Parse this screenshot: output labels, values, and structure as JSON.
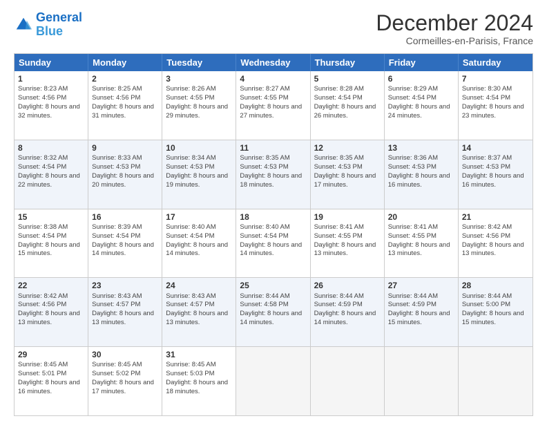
{
  "header": {
    "logo_line1": "General",
    "logo_line2": "Blue",
    "month": "December 2024",
    "location": "Cormeilles-en-Parisis, France"
  },
  "weekdays": [
    "Sunday",
    "Monday",
    "Tuesday",
    "Wednesday",
    "Thursday",
    "Friday",
    "Saturday"
  ],
  "rows": [
    [
      {
        "day": "1",
        "rise": "8:23 AM",
        "set": "4:56 PM",
        "daylight": "8 hours and 32 minutes"
      },
      {
        "day": "2",
        "rise": "8:25 AM",
        "set": "4:56 PM",
        "daylight": "8 hours and 31 minutes"
      },
      {
        "day": "3",
        "rise": "8:26 AM",
        "set": "4:55 PM",
        "daylight": "8 hours and 29 minutes"
      },
      {
        "day": "4",
        "rise": "8:27 AM",
        "set": "4:55 PM",
        "daylight": "8 hours and 27 minutes"
      },
      {
        "day": "5",
        "rise": "8:28 AM",
        "set": "4:54 PM",
        "daylight": "8 hours and 26 minutes"
      },
      {
        "day": "6",
        "rise": "8:29 AM",
        "set": "4:54 PM",
        "daylight": "8 hours and 24 minutes"
      },
      {
        "day": "7",
        "rise": "8:30 AM",
        "set": "4:54 PM",
        "daylight": "8 hours and 23 minutes"
      }
    ],
    [
      {
        "day": "8",
        "rise": "8:32 AM",
        "set": "4:54 PM",
        "daylight": "8 hours and 22 minutes"
      },
      {
        "day": "9",
        "rise": "8:33 AM",
        "set": "4:53 PM",
        "daylight": "8 hours and 20 minutes"
      },
      {
        "day": "10",
        "rise": "8:34 AM",
        "set": "4:53 PM",
        "daylight": "8 hours and 19 minutes"
      },
      {
        "day": "11",
        "rise": "8:35 AM",
        "set": "4:53 PM",
        "daylight": "8 hours and 18 minutes"
      },
      {
        "day": "12",
        "rise": "8:35 AM",
        "set": "4:53 PM",
        "daylight": "8 hours and 17 minutes"
      },
      {
        "day": "13",
        "rise": "8:36 AM",
        "set": "4:53 PM",
        "daylight": "8 hours and 16 minutes"
      },
      {
        "day": "14",
        "rise": "8:37 AM",
        "set": "4:53 PM",
        "daylight": "8 hours and 16 minutes"
      }
    ],
    [
      {
        "day": "15",
        "rise": "8:38 AM",
        "set": "4:54 PM",
        "daylight": "8 hours and 15 minutes"
      },
      {
        "day": "16",
        "rise": "8:39 AM",
        "set": "4:54 PM",
        "daylight": "8 hours and 14 minutes"
      },
      {
        "day": "17",
        "rise": "8:40 AM",
        "set": "4:54 PM",
        "daylight": "8 hours and 14 minutes"
      },
      {
        "day": "18",
        "rise": "8:40 AM",
        "set": "4:54 PM",
        "daylight": "8 hours and 14 minutes"
      },
      {
        "day": "19",
        "rise": "8:41 AM",
        "set": "4:55 PM",
        "daylight": "8 hours and 13 minutes"
      },
      {
        "day": "20",
        "rise": "8:41 AM",
        "set": "4:55 PM",
        "daylight": "8 hours and 13 minutes"
      },
      {
        "day": "21",
        "rise": "8:42 AM",
        "set": "4:56 PM",
        "daylight": "8 hours and 13 minutes"
      }
    ],
    [
      {
        "day": "22",
        "rise": "8:42 AM",
        "set": "4:56 PM",
        "daylight": "8 hours and 13 minutes"
      },
      {
        "day": "23",
        "rise": "8:43 AM",
        "set": "4:57 PM",
        "daylight": "8 hours and 13 minutes"
      },
      {
        "day": "24",
        "rise": "8:43 AM",
        "set": "4:57 PM",
        "daylight": "8 hours and 13 minutes"
      },
      {
        "day": "25",
        "rise": "8:44 AM",
        "set": "4:58 PM",
        "daylight": "8 hours and 14 minutes"
      },
      {
        "day": "26",
        "rise": "8:44 AM",
        "set": "4:59 PM",
        "daylight": "8 hours and 14 minutes"
      },
      {
        "day": "27",
        "rise": "8:44 AM",
        "set": "4:59 PM",
        "daylight": "8 hours and 15 minutes"
      },
      {
        "day": "28",
        "rise": "8:44 AM",
        "set": "5:00 PM",
        "daylight": "8 hours and 15 minutes"
      }
    ],
    [
      {
        "day": "29",
        "rise": "8:45 AM",
        "set": "5:01 PM",
        "daylight": "8 hours and 16 minutes"
      },
      {
        "day": "30",
        "rise": "8:45 AM",
        "set": "5:02 PM",
        "daylight": "8 hours and 17 minutes"
      },
      {
        "day": "31",
        "rise": "8:45 AM",
        "set": "5:03 PM",
        "daylight": "8 hours and 18 minutes"
      },
      null,
      null,
      null,
      null
    ]
  ]
}
